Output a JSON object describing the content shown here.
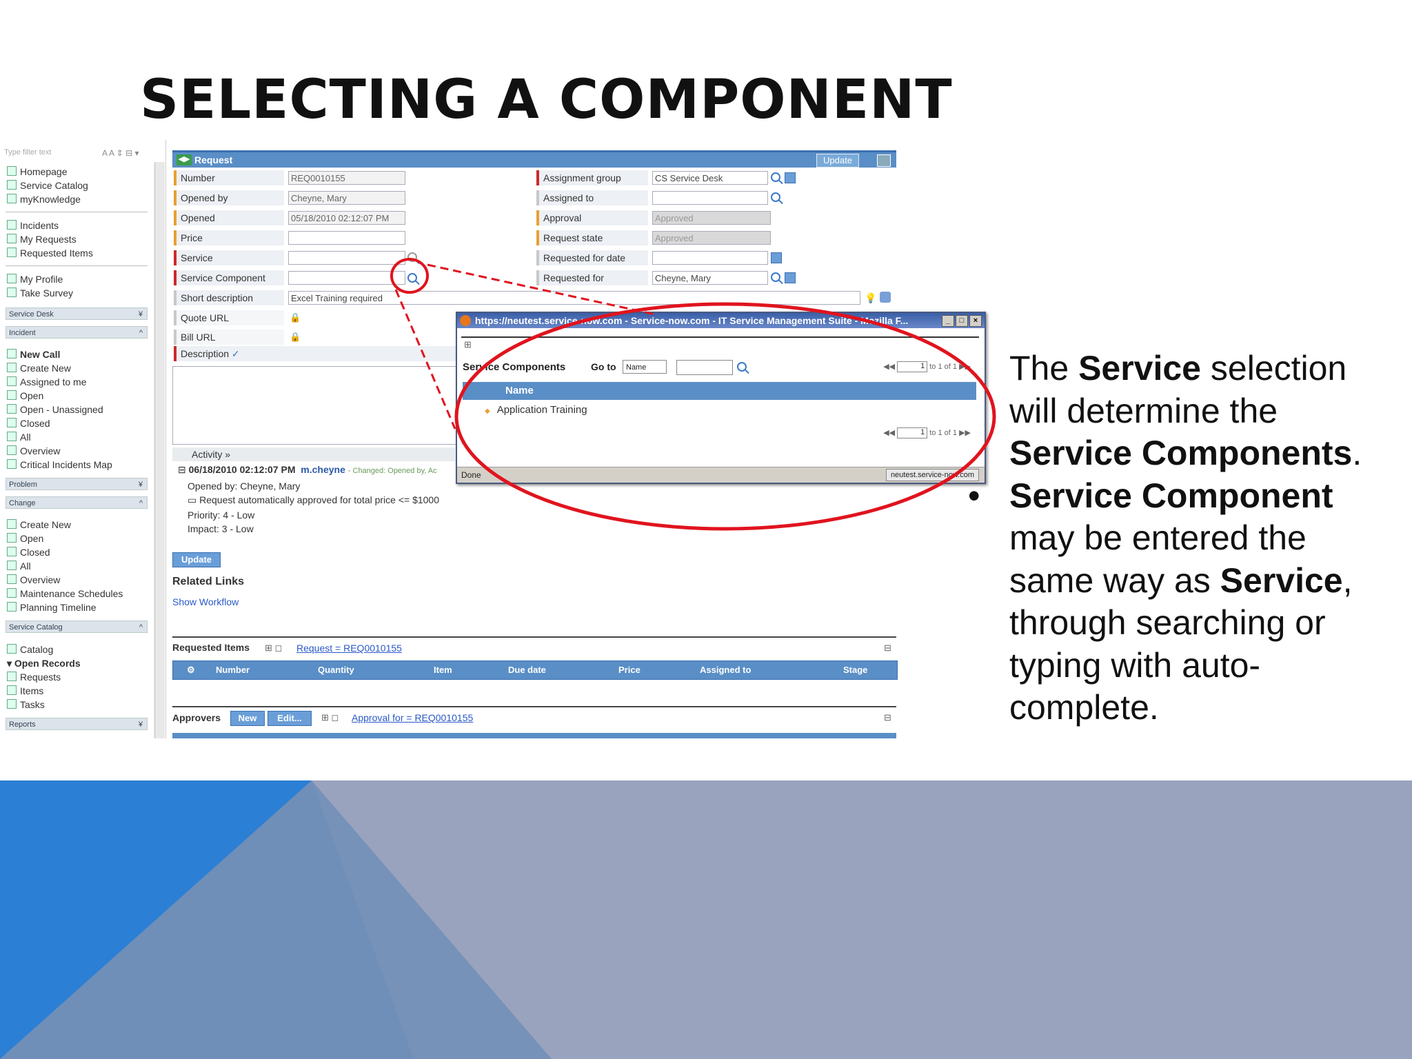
{
  "slide": {
    "title": "SELECTING A COMPONENT",
    "callout": {
      "p1_pre": "The ",
      "p1_b1": "Service",
      "p1_mid": " selection will determine the ",
      "p1_b2": "Service Components",
      "p1_end": ".",
      "bullet_b1": "Service Component",
      "bullet_mid": " may be entered the same way as ",
      "bullet_b2": "Service",
      "bullet_end": ", through searching or typing with auto-complete."
    },
    "colors": {
      "accent_red": "#e0141e",
      "triangle_blue": "#2b7fd4",
      "band_gray": "#9aa3bd"
    }
  },
  "nav": {
    "filter_placeholder": "Type filter text",
    "filter_tools": "A A ⇕ ⊟ ▾",
    "group1": [
      "Homepage",
      "Service Catalog",
      "myKnowledge"
    ],
    "group2": [
      "Incidents",
      "My Requests",
      "Requested Items"
    ],
    "group3": [
      "My Profile",
      "Take Survey"
    ],
    "sections": {
      "service_desk": "Service Desk",
      "incident": "Incident",
      "problem": "Problem",
      "change": "Change",
      "service_catalog": "Service Catalog",
      "reports": "Reports"
    },
    "incident_items": [
      "New Call",
      "Create New",
      "Assigned to me",
      "Open",
      "Open - Unassigned",
      "Closed",
      "All",
      "Overview",
      "Critical Incidents Map"
    ],
    "change_items": [
      "Create New",
      "Open",
      "Closed",
      "All",
      "Overview",
      "Maintenance Schedules",
      "Planning Timeline"
    ],
    "catalog_items": [
      "Catalog",
      "Open Records",
      "Requests",
      "Items",
      "Tasks"
    ]
  },
  "form": {
    "header_title": "Request",
    "header_icon": "◀▶",
    "update_label": "Update",
    "left_labels": {
      "number": "Number",
      "opened_by": "Opened by",
      "opened": "Opened",
      "price": "Price",
      "service": "Service",
      "service_component": "Service Component",
      "short_description": "Short description",
      "quote_url": "Quote URL",
      "bill_url": "Bill URL",
      "description": "Description"
    },
    "left_values": {
      "number": "REQ0010155",
      "opened_by": "Cheyne, Mary",
      "opened": "05/18/2010 02:12:07 PM",
      "price": "",
      "service": "",
      "service_component": "",
      "short_description": "Excel Training required"
    },
    "right_labels": {
      "assignment_group": "Assignment group",
      "assigned_to": "Assigned to",
      "approval": "Approval",
      "request_state": "Request state",
      "requested_for_date": "Requested for date",
      "requested_for": "Requested for"
    },
    "right_values": {
      "assignment_group": "CS Service Desk",
      "assigned_to": "",
      "approval": "Approved",
      "request_state": "Approved",
      "requested_for_date": "",
      "requested_for": "Cheyne, Mary"
    },
    "activity": {
      "header": "Activity",
      "header_arrow": "»",
      "timestamp": "06/18/2010 02:12:07 PM",
      "user": "m.cheyne",
      "changed": "- Changed: Opened by, Ac",
      "lines": [
        "Opened by: Cheyne, Mary",
        "Request automatically approved for total price <= $1000",
        "Priority: 4 - Low",
        "Impact: 3 - Low"
      ]
    },
    "update_button": "Update",
    "related_links_title": "Related Links",
    "show_workflow": "Show Workflow",
    "requested_items": {
      "title": "Requested Items",
      "filter_link": "Request = REQ0010155",
      "columns": [
        "Number",
        "Quantity",
        "Item",
        "Due date",
        "Price",
        "Assigned to",
        "Stage"
      ]
    },
    "approvers": {
      "title": "Approvers",
      "new_label": "New",
      "edit_label": "Edit...",
      "filter_link": "Approval for = REQ0010155"
    }
  },
  "popup": {
    "window_title": "https://neutest.service-now.com - Service-now.com - IT Service Management Suite - Mozilla F...",
    "list_title": "Service Components",
    "goto_label": "Go to",
    "goto_select": "Name",
    "pager_value": "1",
    "pager_text": "to 1 of 1",
    "column_name": "Name",
    "rows": [
      "Application Training"
    ],
    "status_left": "Done",
    "status_right": "neutest.service-now.com"
  }
}
